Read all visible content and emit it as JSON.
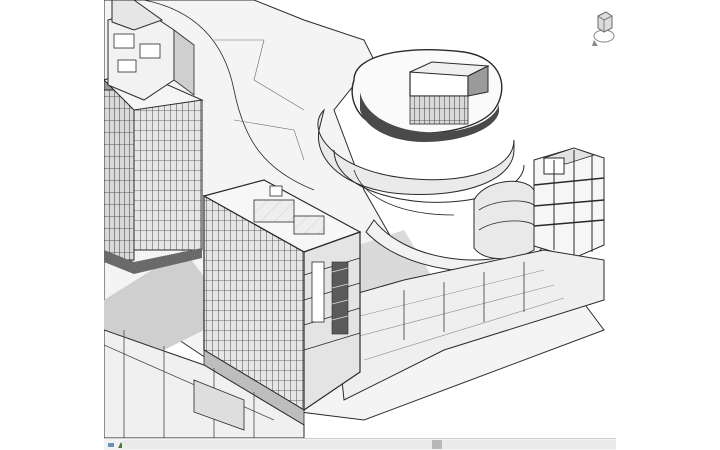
{
  "view": {
    "type": "3D View",
    "tools": [
      {
        "name": "scale-icon"
      },
      {
        "name": "detail-level-icon"
      },
      {
        "name": "visual-style-icon"
      },
      {
        "name": "sun-path-icon"
      },
      {
        "name": "shadows-icon"
      },
      {
        "name": "crop-view-icon"
      },
      {
        "name": "show-crop-icon"
      },
      {
        "name": "lock-view-icon"
      },
      {
        "name": "temporary-hide-icon"
      },
      {
        "name": "reveal-hidden-icon"
      },
      {
        "name": "collapse-icon"
      }
    ],
    "scrollbar": {
      "position": 0.64
    }
  },
  "colors": {
    "line": "#2a2a2a",
    "facade_dark": "#5a5a5a",
    "shadow": "#cfcfcf",
    "floor": "#ededed",
    "background": "#ffffff",
    "statusbar": "#f2f2f2"
  }
}
